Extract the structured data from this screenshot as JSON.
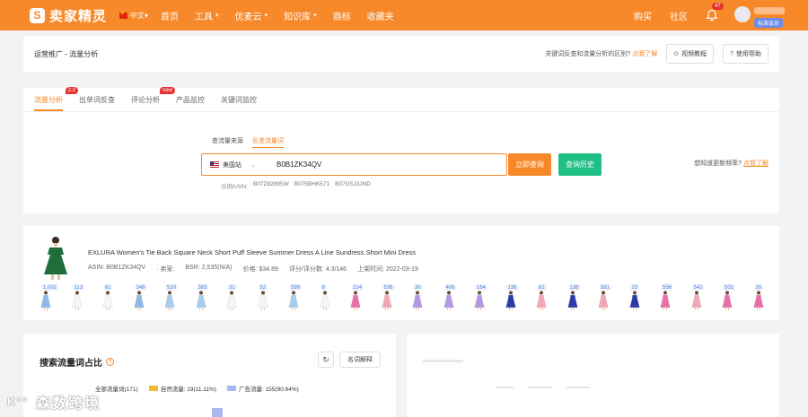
{
  "topbar": {
    "logo_mark": "S",
    "logo_text": "卖家精灵",
    "language": "中文",
    "nav": [
      {
        "label": "首页",
        "dropdown": false
      },
      {
        "label": "工具",
        "dropdown": true
      },
      {
        "label": "优麦云",
        "dropdown": true
      },
      {
        "label": "知识库",
        "dropdown": true
      },
      {
        "label": "商标",
        "dropdown": false
      },
      {
        "label": "收藏夹",
        "dropdown": false
      }
    ],
    "right": {
      "buy": "购买",
      "community": "社区",
      "notifications": "47",
      "member_badge": "标准会员"
    },
    "color": "#f7892a"
  },
  "breadcrumb": {
    "path": "运营推广 - 流量分析",
    "question": "关键词反查和流量分析的区别?",
    "question_link": "点我了解",
    "video_btn": "视频教程",
    "help_btn": "使用帮助"
  },
  "tabs": [
    {
      "label": "流量分析",
      "badge": "2.0",
      "active": true
    },
    {
      "label": "出单词反查",
      "badge": "",
      "active": false
    },
    {
      "label": "评论分析",
      "badge": "new",
      "active": false
    },
    {
      "label": "产品监控",
      "badge": "",
      "active": false
    },
    {
      "label": "关键词监控",
      "badge": "",
      "active": false
    }
  ],
  "search": {
    "sub_tabs": [
      {
        "label": "查流量来源",
        "active": false
      },
      {
        "label": "反查流量词",
        "active": true
      }
    ],
    "site": "美国站",
    "value": "B0B1ZK34QV",
    "query_btn": "立即查询",
    "history_btn": "查询历史",
    "examples_label": "示例ASIN:",
    "examples": [
      "B07Z82895W",
      "B075BHK571",
      "B07G5J3JND"
    ],
    "update_tip": "想知道更新频率?",
    "update_link": "点我了解"
  },
  "product": {
    "title": "EXLURA Women's Tie Back Square Neck Short Puff Sleeve Summer Dress A Line Sundress Short Mini Dress",
    "asin": "ASIN: B0B1ZK34QV",
    "seller": "· 卖家:",
    "bsr": "BSR: 2,535(N/A)",
    "price": "价格: $34.89",
    "rating": "评分/评分数: 4.3/146",
    "launch": "上架时间: 2022-03-19",
    "variants": [
      {
        "count": "1,002",
        "color": "#8fb8e8"
      },
      {
        "count": "113",
        "color": "#f5f5f5"
      },
      {
        "count": "61",
        "color": "#f5f5f5"
      },
      {
        "count": "349",
        "color": "#8fb8e8"
      },
      {
        "count": "520",
        "color": "#a8cdec"
      },
      {
        "count": "383",
        "color": "#a8cdec"
      },
      {
        "count": "31",
        "color": "#f5f5f5"
      },
      {
        "count": "52",
        "color": "#f5f5f5"
      },
      {
        "count": "599",
        "color": "#a8cdec"
      },
      {
        "count": "8",
        "color": "#f5f5f5"
      },
      {
        "count": "214",
        "color": "#e86fa8"
      },
      {
        "count": "536",
        "color": "#f0a8b8"
      },
      {
        "count": "30",
        "color": "#b39ae0"
      },
      {
        "count": "406",
        "color": "#b39ae0"
      },
      {
        "count": "164",
        "color": "#b39ae0"
      },
      {
        "count": "136",
        "color": "#2a3aa8"
      },
      {
        "count": "82",
        "color": "#f0a8b8"
      },
      {
        "count": "138",
        "color": "#2a3aa8"
      },
      {
        "count": "581",
        "color": "#f0a8b8"
      },
      {
        "count": "23",
        "color": "#2a3aa8"
      },
      {
        "count": "556",
        "color": "#e86fa8"
      },
      {
        "count": "542",
        "color": "#f0a8b8"
      },
      {
        "count": "502",
        "color": "#e86fa8"
      },
      {
        "count": "20",
        "color": "#e86fa8"
      }
    ]
  },
  "share": {
    "title": "搜索流量词占比",
    "term_btn": "名词解释",
    "legend": [
      {
        "label": "全部流量词(171)",
        "color": ""
      },
      {
        "label": "自然流量: 19(11.11%)",
        "color": "#f5b731"
      },
      {
        "label": "广告流量: 155(90.64%)",
        "color": "#a9b8f0"
      }
    ]
  },
  "watermark": "森数跨境"
}
